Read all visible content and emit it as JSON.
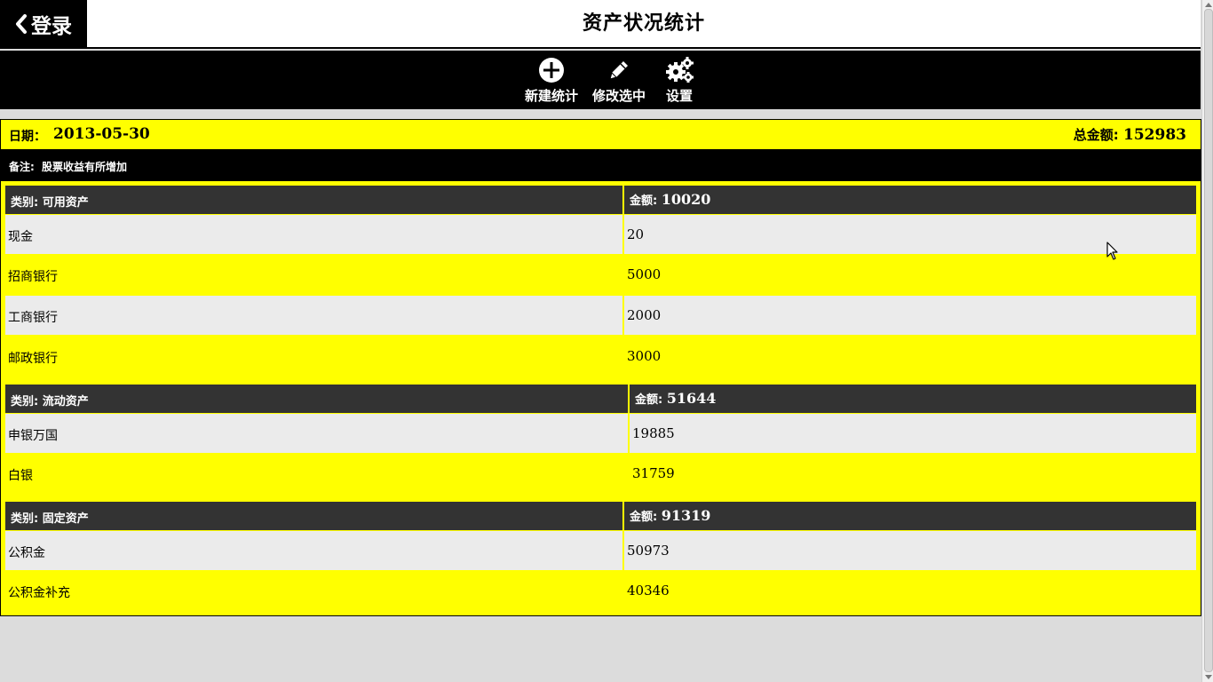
{
  "header": {
    "back_label": "登录",
    "title": "资产状况统计"
  },
  "toolbar": {
    "items": [
      {
        "label": "新建统计",
        "icon": "plus-circle-icon"
      },
      {
        "label": "修改选中",
        "icon": "pencil-icon"
      },
      {
        "label": "设置",
        "icon": "gears-icon"
      }
    ]
  },
  "record": {
    "date_label": "日期：",
    "date": "2013-05-30",
    "total_label": "总金额: ",
    "total": "152983",
    "note_label": "备注:",
    "note": "股票收益有所增加",
    "groups": [
      {
        "category_label": "类别: 可用资产",
        "amount_label": "金额: ",
        "amount": "10020",
        "items": [
          {
            "name": "现金",
            "value": "20"
          },
          {
            "name": "招商银行",
            "value": "5000"
          },
          {
            "name": "工商银行",
            "value": "2000"
          },
          {
            "name": "邮政银行",
            "value": "3000"
          }
        ]
      },
      {
        "category_label": "类别: 流动资产",
        "amount_label": "金额: ",
        "amount": "51644",
        "items": [
          {
            "name": "申银万国",
            "value": "19885"
          },
          {
            "name": "白银",
            "value": "31759"
          }
        ]
      },
      {
        "category_label": "类别: 固定资产",
        "amount_label": "金额: ",
        "amount": "91319",
        "items": [
          {
            "name": "公积金",
            "value": "50973"
          },
          {
            "name": "公积金补充",
            "value": "40346"
          }
        ]
      }
    ]
  },
  "colors": {
    "card_bg": "#ffff00",
    "header_dark": "#000000",
    "category_bg": "#333333",
    "row_shade": "#ebebeb",
    "page_bg": "#dcdcdc"
  }
}
